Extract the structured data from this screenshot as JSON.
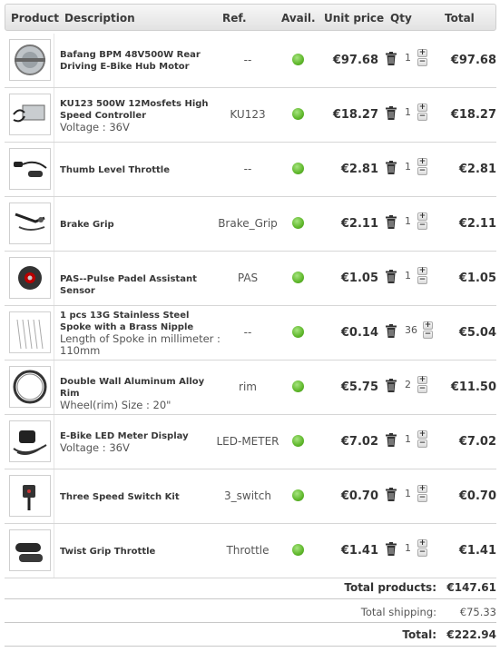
{
  "header": {
    "product": "Product",
    "description": "Description",
    "ref": "Ref.",
    "avail": "Avail.",
    "unit_price": "Unit price",
    "qty": "Qty",
    "total": "Total"
  },
  "items": [
    {
      "name": "Bafang BPM 48V500W Rear Driving E-Bike Hub Motor",
      "attr": "",
      "ref": "--",
      "unit_price": "€97.68",
      "qty": "1",
      "total": "€97.68",
      "image": "hub-motor-image"
    },
    {
      "name": "KU123 500W 12Mosfets High Speed Controller",
      "attr": "Voltage : 36V",
      "ref": "KU123",
      "unit_price": "€18.27",
      "qty": "1",
      "total": "€18.27",
      "image": "controller-image"
    },
    {
      "name": "Thumb Level Throttle",
      "attr": "",
      "ref": "--",
      "unit_price": "€2.81",
      "qty": "1",
      "total": "€2.81",
      "image": "thumb-throttle-image"
    },
    {
      "name": "Brake Grip",
      "attr": "",
      "ref": "Brake_Grip",
      "unit_price": "€2.11",
      "qty": "1",
      "total": "€2.11",
      "image": "brake-grip-image"
    },
    {
      "name": "PAS--Pulse Padel Assistant Sensor",
      "attr": "",
      "ref": "PAS",
      "unit_price": "€1.05",
      "qty": "1",
      "total": "€1.05",
      "image": "pas-sensor-image"
    },
    {
      "name": "1 pcs 13G Stainless Steel Spoke with a Brass Nipple",
      "attr": "Length of Spoke in millimeter : 110mm",
      "ref": "--",
      "unit_price": "€0.14",
      "qty": "36",
      "total": "€5.04",
      "image": "spoke-image"
    },
    {
      "name": "Double Wall Aluminum Alloy Rim",
      "attr": "Wheel(rim) Size : 20\"",
      "ref": "rim",
      "unit_price": "€5.75",
      "qty": "2",
      "total": "€11.50",
      "image": "rim-image"
    },
    {
      "name": "E-Bike LED Meter Display",
      "attr": "Voltage : 36V",
      "ref": "LED-METER",
      "unit_price": "€7.02",
      "qty": "1",
      "total": "€7.02",
      "image": "led-meter-image"
    },
    {
      "name": "Three Speed Switch Kit",
      "attr": "",
      "ref": "3_switch",
      "unit_price": "€0.70",
      "qty": "1",
      "total": "€0.70",
      "image": "switch-kit-image"
    },
    {
      "name": "Twist Grip Throttle",
      "attr": "",
      "ref": "Throttle",
      "unit_price": "€1.41",
      "qty": "1",
      "total": "€1.41",
      "image": "twist-throttle-image"
    }
  ],
  "summary": {
    "total_products_label": "Total products:",
    "total_products_value": "€147.61",
    "total_shipping_label": "Total shipping:",
    "total_shipping_value": "€75.33",
    "total_label": "Total:",
    "total_value": "€222.94"
  },
  "colors": {
    "available": "#5fb72b",
    "header_bg": "#e9e9e9",
    "row_border": "#d6d6d6"
  },
  "icons": {
    "delete": "trash-icon",
    "increase": "plus-icon",
    "decrease": "minus-icon",
    "availability": "availability-dot-icon"
  }
}
